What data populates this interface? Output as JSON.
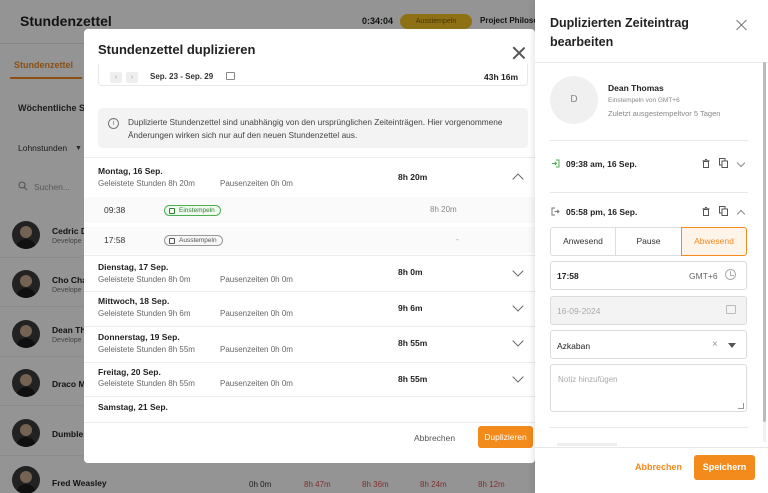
{
  "app": {
    "title": "Stundenzettel",
    "timer": "0:34:04",
    "status_badge": "Ausstempeln",
    "project": "Project Philosop",
    "tab_active": "Stundenzettel",
    "weekly_label": "Wöchentliche St",
    "lohn_label": "Lohnstunden",
    "search_placeholder": "Suchen...",
    "people": [
      {
        "name": "Cedric D",
        "sub": "Develope"
      },
      {
        "name": "Cho Chan",
        "sub": "Develope"
      },
      {
        "name": "Dean Th",
        "sub": "Develope"
      },
      {
        "name": "Draco M",
        "sub": ""
      },
      {
        "name": "Dumble",
        "sub": ""
      }
    ],
    "footer_row": {
      "name": "Fred Weasley",
      "cells": [
        "0h 0m",
        "8h 47m",
        "8h 36m",
        "8h 24m",
        "8h 12m"
      ]
    },
    "accent": "#f28a1c"
  },
  "modal": {
    "title": "Stundenzettel duplizieren",
    "week_range": "Sep. 23 - Sep. 29",
    "week_total": "43h 16m",
    "info": "Duplizierte Stundenzettel sind unabhängig von den ursprünglichen Zeiteinträgen. Hier vorgenommene Änderungen wirken sich nur auf den neuen Stundenzettel aus.",
    "days": [
      {
        "name": "Montag, 16 Sep.",
        "worked": "Geleistete Stunden 8h 20m",
        "pause": "Pausenzeiten 0h 0m",
        "total": "8h 20m"
      },
      {
        "name": "Dienstag, 17 Sep.",
        "worked": "Geleistete Stunden 8h 0m",
        "pause": "Pausenzeiten 0h 0m",
        "total": "8h 0m"
      },
      {
        "name": "Mittwoch, 18 Sep.",
        "worked": "Geleistete Stunden 9h 6m",
        "pause": "Pausenzeiten 0h 0m",
        "total": "9h 6m"
      },
      {
        "name": "Donnerstag, 19 Sep.",
        "worked": "Geleistete Stunden 8h 55m",
        "pause": "Pausenzeiten 0h 0m",
        "total": "8h 55m"
      },
      {
        "name": "Freitag, 20 Sep.",
        "worked": "Geleistete Stunden 8h 55m",
        "pause": "Pausenzeiten 0h 0m",
        "total": "8h 55m"
      },
      {
        "name": "Samstag, 21 Sep.",
        "worked": "",
        "pause": "",
        "total": ""
      }
    ],
    "entries": [
      {
        "time": "09:38",
        "badge": "Einstempeln",
        "duration": "8h 20m"
      },
      {
        "time": "17:58",
        "badge": "Ausstempeln",
        "duration": "-"
      }
    ],
    "cancel_label": "Abbrechen",
    "duplicate_label": "Duplizieren"
  },
  "panel": {
    "title": "Duplizierten Zeiteintrag bearbeiten",
    "user": {
      "initial": "D",
      "name": "Dean Thomas",
      "sub": "Einstempeln von GMT+6",
      "last": "Zuletzt ausgestempeltvor 5 Tagen"
    },
    "clock_in": "09:38 am, 16 Sep.",
    "clock_out": "05:58 pm, 16 Sep.",
    "segments": [
      "Anwesend",
      "Pause",
      "Abwesend"
    ],
    "active_segment": "Abwesend",
    "time_value": "17:58",
    "timezone": "GMT+6",
    "date_value": "16-09-2024",
    "location": "Azkaban",
    "notes_placeholder": "Notiz hinzufügen",
    "cancel_label": "Abbrechen",
    "save_label": "Speichern"
  }
}
